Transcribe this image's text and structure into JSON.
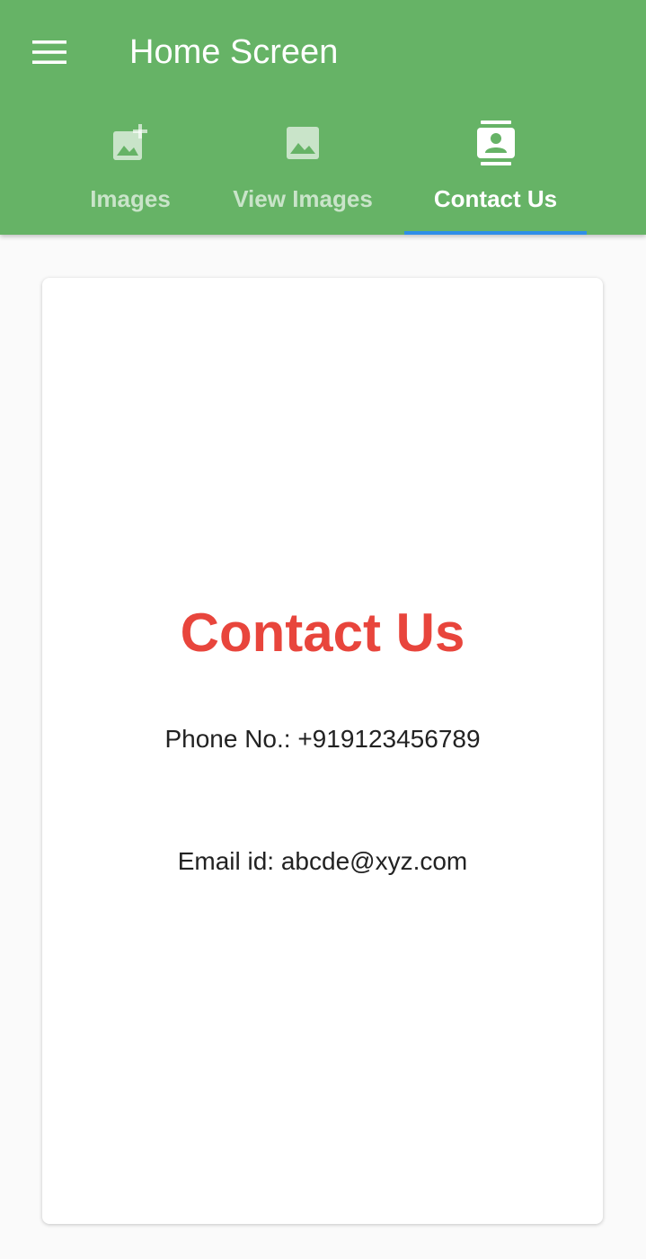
{
  "colors": {
    "app_bar": "#66b366",
    "indicator": "#2f8ee8",
    "heading": "#e8453c",
    "background": "#fafafa",
    "card": "#ffffff"
  },
  "app_bar": {
    "menu_icon": "hamburger-menu-icon",
    "title": "Home Screen"
  },
  "tabs": [
    {
      "label": "Images",
      "icon": "add-photo-icon",
      "active": false
    },
    {
      "label": "View Images",
      "icon": "image-icon",
      "active": false
    },
    {
      "label": "Contact Us",
      "icon": "contacts-icon",
      "active": true
    }
  ],
  "card": {
    "heading": "Contact Us",
    "phone": "Phone No.: +919123456789",
    "email": "Email id: abcde@xyz.com"
  }
}
